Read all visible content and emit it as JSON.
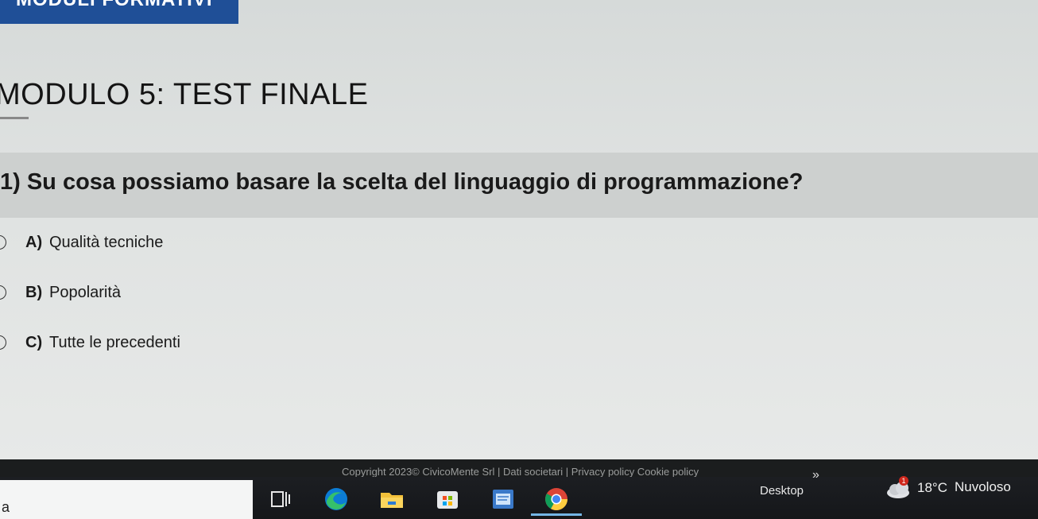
{
  "header": {
    "tab_label": "MODULI FORMATIVI",
    "module_title": "MODULO 5: TEST FINALE"
  },
  "question": {
    "text": "1) Su cosa possiamo basare la scelta del linguaggio di programmazione?",
    "options": [
      {
        "letter": "A)",
        "text": "Qualità tecniche"
      },
      {
        "letter": "B)",
        "text": "Popolarità"
      },
      {
        "letter": "C)",
        "text": "Tutte le precedenti"
      }
    ]
  },
  "footer": {
    "text": "Copyright 2023© CivicoMente Srl | Dati societari | Privacy policy  Cookie policy"
  },
  "taskbar": {
    "search_value": "a",
    "desktop_label": "Desktop",
    "chevrons": "»",
    "weather_badge": "1",
    "temperature": "18°C",
    "condition": "Nuvoloso",
    "icons": [
      "task-view-icon",
      "edge-icon",
      "file-explorer-icon",
      "store-icon",
      "notes-app-icon",
      "chrome-icon"
    ]
  }
}
